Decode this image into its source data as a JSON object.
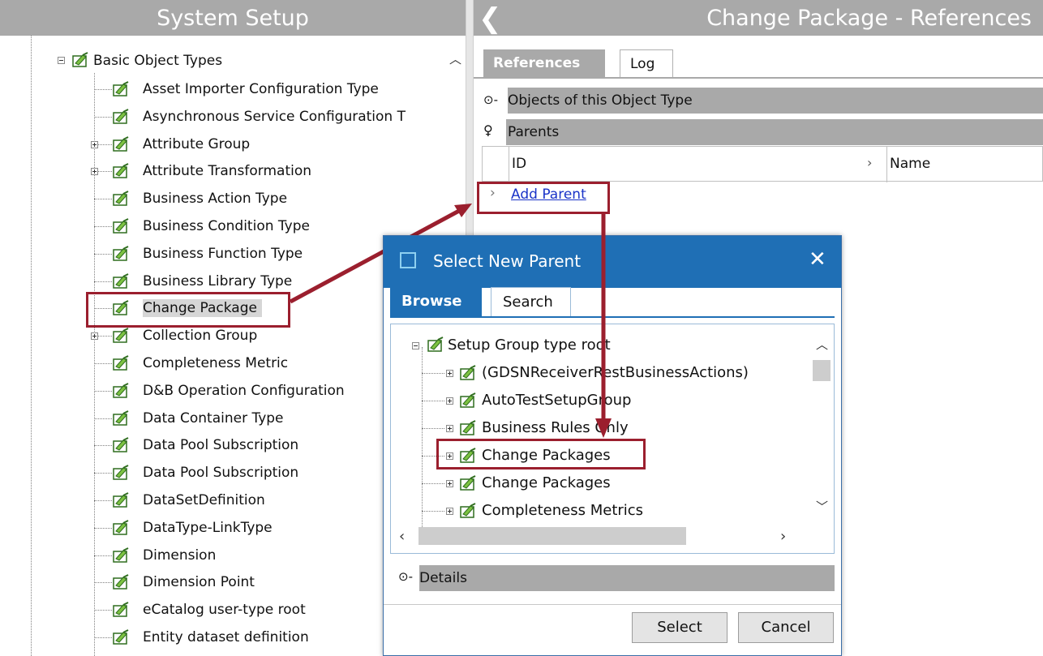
{
  "left_panel": {
    "title": "System Setup",
    "root_label": "Basic Object Types",
    "items": [
      {
        "label": "Asset Importer Configuration Type",
        "expandable": false
      },
      {
        "label": "Asynchronous Service Configuration T",
        "expandable": false
      },
      {
        "label": "Attribute Group",
        "expandable": true
      },
      {
        "label": "Attribute Transformation",
        "expandable": true
      },
      {
        "label": "Business Action Type",
        "expandable": false
      },
      {
        "label": "Business Condition Type",
        "expandable": false
      },
      {
        "label": "Business Function Type",
        "expandable": false
      },
      {
        "label": "Business Library Type",
        "expandable": false
      },
      {
        "label": "Change Package",
        "expandable": false,
        "selected": true
      },
      {
        "label": "Collection Group",
        "expandable": true
      },
      {
        "label": "Completeness Metric",
        "expandable": false
      },
      {
        "label": "D&B Operation Configuration",
        "expandable": false
      },
      {
        "label": "Data Container Type",
        "expandable": false
      },
      {
        "label": "Data Pool Subscription",
        "expandable": false
      },
      {
        "label": "Data Pool Subscription",
        "expandable": false
      },
      {
        "label": "DataSetDefinition",
        "expandable": false
      },
      {
        "label": "DataType-LinkType",
        "expandable": false
      },
      {
        "label": "Dimension",
        "expandable": false
      },
      {
        "label": "Dimension Point",
        "expandable": false
      },
      {
        "label": "eCatalog user-type root",
        "expandable": false
      },
      {
        "label": "Entity dataset definition",
        "expandable": false
      }
    ]
  },
  "right_panel": {
    "title": "Change Package - References",
    "back_icon": "chevron-left-icon",
    "tabs": [
      {
        "label": "References",
        "active": true
      },
      {
        "label": "Log",
        "active": false
      }
    ],
    "sections": {
      "objects_of_type": "Objects of this  Object Type",
      "parents": "Parents"
    },
    "grid_columns": [
      "ID",
      "Name"
    ],
    "add_parent_link": "Add Parent"
  },
  "dialog": {
    "title": "Select New Parent",
    "tabs": [
      {
        "label": "Browse",
        "active": true
      },
      {
        "label": "Search",
        "active": false
      }
    ],
    "tree_root": "Setup Group type root",
    "tree_items": [
      {
        "label": "(GDSNReceiverRestBusinessActions)"
      },
      {
        "label": "AutoTestSetupGroup"
      },
      {
        "label": "Business Rules Only"
      },
      {
        "label": "Change Packages",
        "highlighted": true
      },
      {
        "label": "Change Packages"
      },
      {
        "label": "Completeness Metrics"
      }
    ],
    "details_label": "Details",
    "buttons": {
      "select": "Select",
      "cancel": "Cancel"
    }
  },
  "colors": {
    "header_gray": "#a9a9a9",
    "dialog_blue": "#1f6fb5",
    "highlight_red": "#9b1f2e",
    "link_blue": "#1a33c8"
  }
}
